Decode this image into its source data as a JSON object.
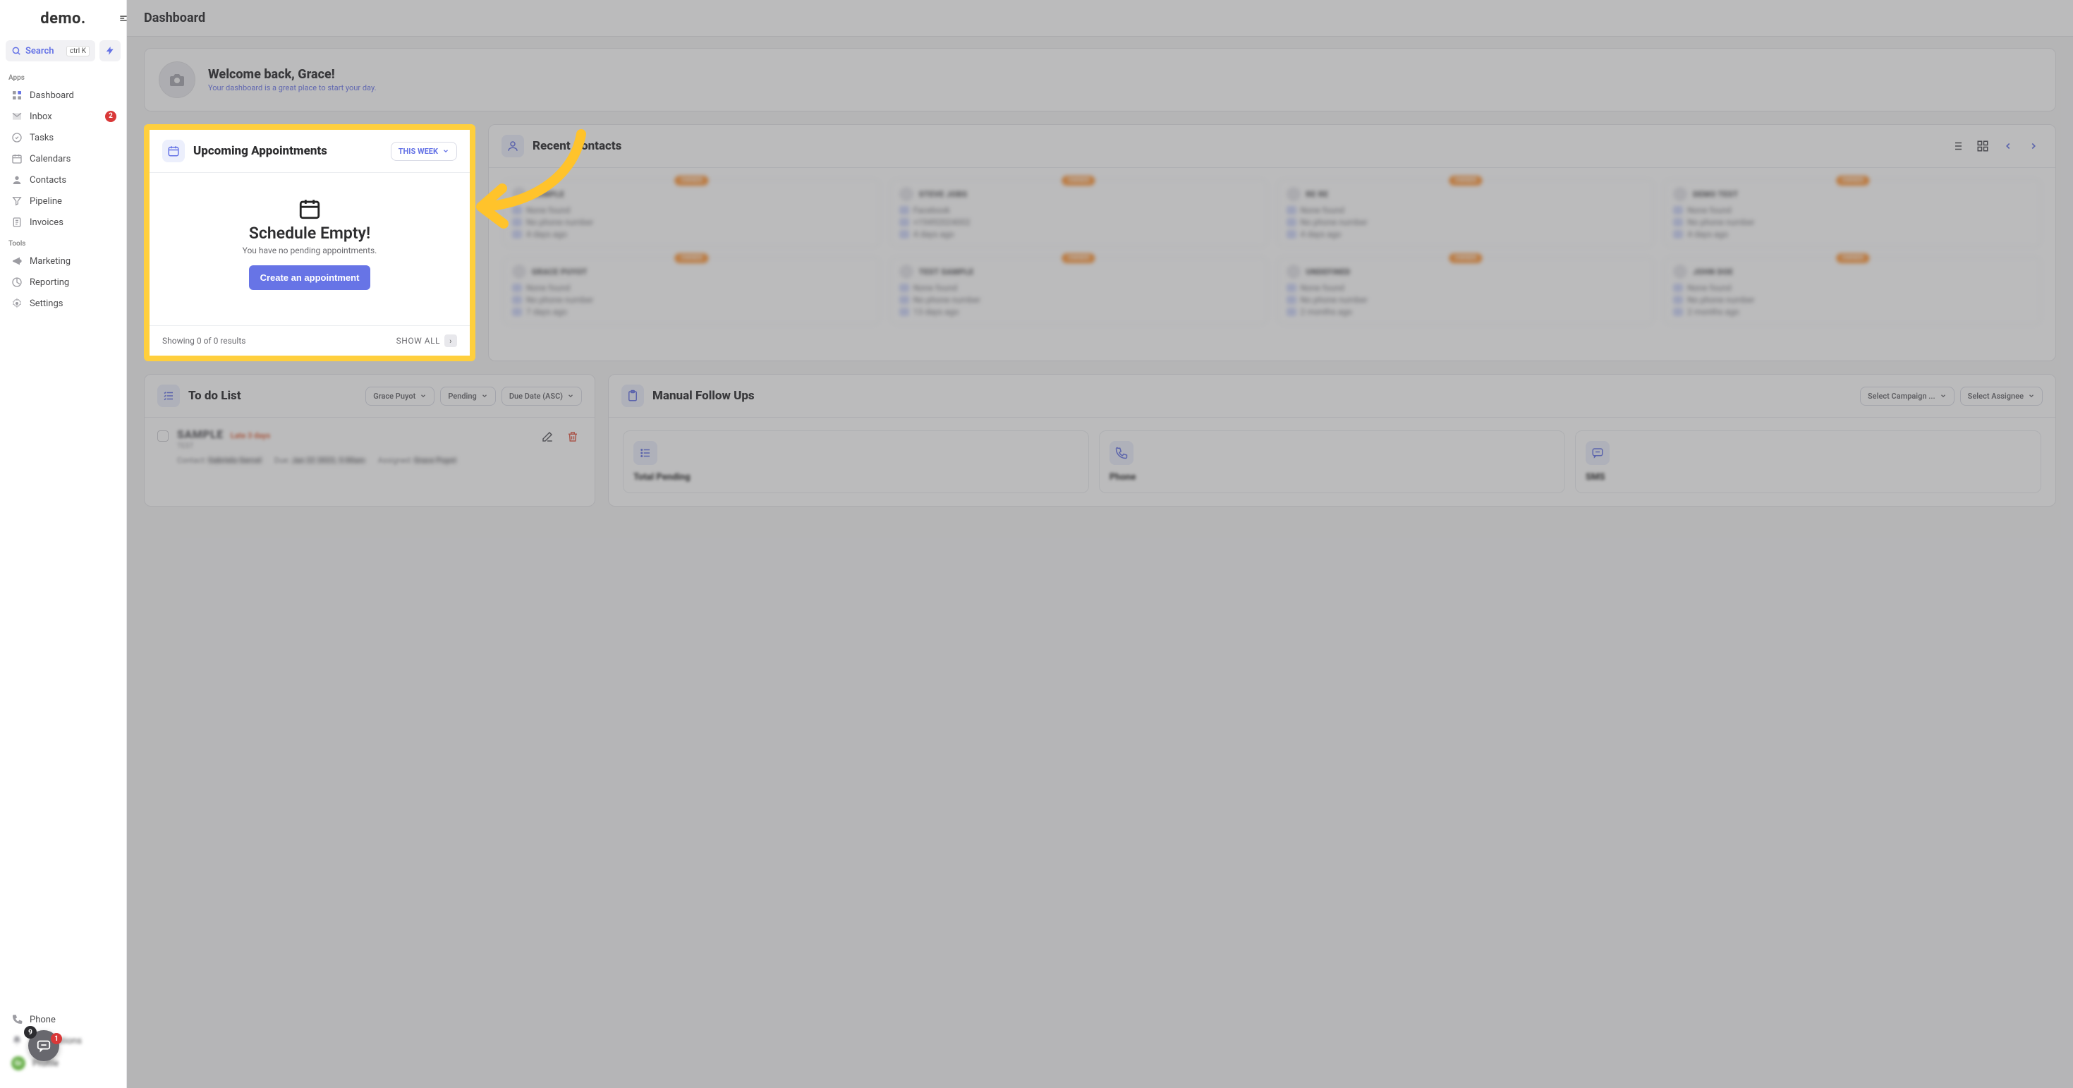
{
  "brand": {
    "logo_text": "demo."
  },
  "sidebar": {
    "search_label": "Search",
    "search_shortcut": "ctrl K",
    "apps_label": "Apps",
    "tools_label": "Tools",
    "apps": [
      {
        "label": "Dashboard",
        "icon": "dashboard"
      },
      {
        "label": "Inbox",
        "icon": "inbox",
        "badge": "2"
      },
      {
        "label": "Tasks",
        "icon": "tasks"
      },
      {
        "label": "Calendars",
        "icon": "calendar"
      },
      {
        "label": "Contacts",
        "icon": "contacts"
      },
      {
        "label": "Pipeline",
        "icon": "pipeline"
      },
      {
        "label": "Invoices",
        "icon": "invoices"
      }
    ],
    "tools": [
      {
        "label": "Marketing",
        "icon": "marketing"
      },
      {
        "label": "Reporting",
        "icon": "reporting"
      },
      {
        "label": "Settings",
        "icon": "settings"
      }
    ],
    "bottom": [
      {
        "label": "Phone",
        "icon": "phone"
      },
      {
        "label": "Notifications",
        "icon": "notifications"
      },
      {
        "label": "Profile",
        "icon": "profile",
        "avatar_text": "Gr"
      }
    ],
    "float_widget": {
      "count_dark": "9",
      "count_red": "1"
    }
  },
  "topbar": {
    "title": "Dashboard"
  },
  "welcome": {
    "heading": "Welcome back, Grace!",
    "sub": "Your dashboard is a great place to start your day."
  },
  "upcoming": {
    "title": "Upcoming Appointments",
    "filter_label": "THIS WEEK",
    "empty_title": "Schedule Empty!",
    "empty_sub": "You have no pending appointments.",
    "create_btn": "Create an appointment",
    "footer_results": "Showing 0 of 0 results",
    "showall": "SHOW ALL"
  },
  "recent_contacts": {
    "title": "Recent Contacts",
    "cards": [
      {
        "owner": "OWNER",
        "name": "SAMPLE",
        "lines": [
          "None found",
          "No phone number",
          "4 days ago"
        ]
      },
      {
        "owner": "OWNER",
        "name": "STEVE JOBS",
        "lines": [
          "Facebook",
          "+19492024002",
          "4 days ago"
        ]
      },
      {
        "owner": "OWNER",
        "name": "RE RE",
        "lines": [
          "None found",
          "No phone number",
          "4 days ago"
        ]
      },
      {
        "owner": "OWNER",
        "name": "DEMO TEST",
        "lines": [
          "None found",
          "No phone number",
          "4 days ago"
        ]
      },
      {
        "owner": "OWNER",
        "name": "GRACE PUYOT",
        "lines": [
          "None found",
          "No phone number",
          "7 days ago"
        ]
      },
      {
        "owner": "OWNER",
        "name": "TEST SAMPLE",
        "lines": [
          "None found",
          "No phone number",
          "13 days ago"
        ]
      },
      {
        "owner": "OWNER",
        "name": "UNDEFINED",
        "lines": [
          "None found",
          "No phone number",
          "2 months ago"
        ]
      },
      {
        "owner": "OWNER",
        "name": "JOHN DOE",
        "lines": [
          "None found",
          "No phone number",
          "2 months ago"
        ]
      }
    ]
  },
  "todo": {
    "title": "To do List",
    "filters": {
      "assignee": "Grace Puyot",
      "status": "Pending",
      "sort": "Due Date (ASC)"
    },
    "item": {
      "title": "SAMPLE",
      "late": "Late 3 days",
      "sub": "TEST",
      "contact_label": "Contact:",
      "contact_value": "Gabriela Gercel",
      "due_label": "Due:",
      "due_value": "Jan 22 2023, 5:00am",
      "assigned_label": "Assigned:",
      "assigned_value": "Grace Puyot"
    }
  },
  "followups": {
    "title": "Manual Follow Ups",
    "filters": {
      "campaign": "Select Campaign ...",
      "assignee": "Select Assignee"
    },
    "stats": [
      {
        "icon": "list",
        "title": "Total Pending"
      },
      {
        "icon": "phone",
        "title": "Phone"
      },
      {
        "icon": "sms",
        "title": "SMS"
      }
    ]
  }
}
